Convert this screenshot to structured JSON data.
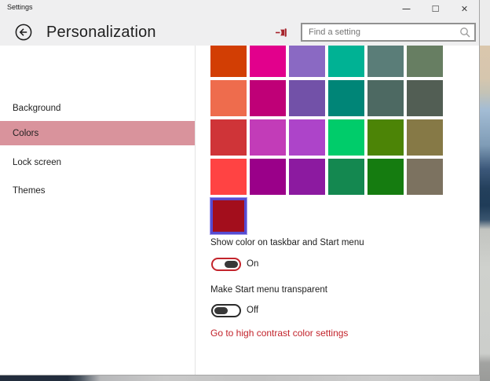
{
  "window": {
    "title": "Settings"
  },
  "titlebar": {
    "minimize": "—",
    "maximize": "☐",
    "close": "✕"
  },
  "header": {
    "title": "Personalization",
    "search_placeholder": "Find a setting"
  },
  "sidebar": {
    "selected_index": 1,
    "items": [
      {
        "label": "Background"
      },
      {
        "label": "Colors"
      },
      {
        "label": "Lock screen"
      },
      {
        "label": "Themes"
      }
    ]
  },
  "colors_page": {
    "swatch_rows": [
      [
        "#d23e04",
        "#e2008c",
        "#8a69c3",
        "#00b294",
        "#5a7d78",
        "#677e62"
      ],
      [
        "#ee6c4d",
        "#bf0077",
        "#7251a8",
        "#008577",
        "#4d6962",
        "#525e54"
      ],
      [
        "#cf3438",
        "#c23cb8",
        "#ad44c9",
        "#00cc6a",
        "#4c8406",
        "#867946"
      ],
      [
        "#ff4343",
        "#9a0089",
        "#8c1aa0",
        "#148850",
        "#157c10",
        "#7c7260"
      ],
      [
        "#a30e1c"
      ]
    ],
    "selected_swatch": {
      "row": 4,
      "col": 0,
      "color": "#a30e1c",
      "border_color": "#564bd2"
    },
    "toggle1": {
      "label": "Show color on taskbar and Start menu",
      "state": "On"
    },
    "toggle2": {
      "label": "Make Start menu transparent",
      "state": "Off"
    },
    "link": {
      "label": "Go to high contrast color settings",
      "color": "#c2232b"
    }
  },
  "colors": {
    "sidebar_highlight": "#d9939c",
    "toggle_on_border": "#c3242c",
    "toggle_off_border": "#2b2b2b",
    "pin_red": "#a6242c",
    "topband_bg": "#efeff0"
  }
}
